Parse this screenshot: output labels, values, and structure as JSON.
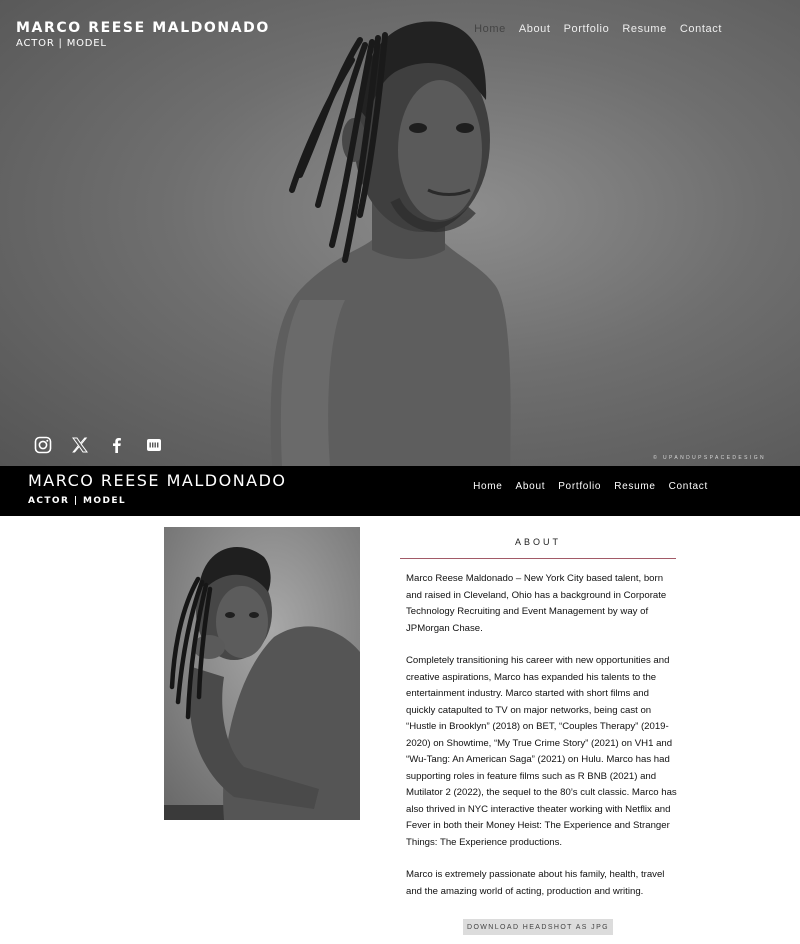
{
  "site": {
    "name": "MARCO REESE MALDONADO",
    "role": "ACTOR | MODEL",
    "bar_role": "ACTOR | MODEL"
  },
  "nav": {
    "items": [
      {
        "label": "Home"
      },
      {
        "label": "About"
      },
      {
        "label": "Portfolio"
      },
      {
        "label": "Resume"
      },
      {
        "label": "Contact"
      }
    ]
  },
  "hero": {
    "credit": "© UPANDUPSPACEDESIGN",
    "social": [
      "instagram-icon",
      "x-twitter-icon",
      "facebook-icon",
      "imdb-icon"
    ]
  },
  "about": {
    "title": "ABOUT",
    "paragraphs": [
      "Marco Reese Maldonado – New York City based talent, born and raised in Cleveland, Ohio has a background in Corporate Technology Recruiting and Event Management by way of JPMorgan Chase.",
      "Completely transitioning his career with new opportunities and creative aspirations, Marco has expanded his talents to the entertainment industry. Marco started with short films and quickly catapulted to TV on major networks, being cast on “Hustle in Brooklyn” (2018) on BET,  “Couples Therapy” (2019-2020) on Showtime, “My True Crime Story” (2021) on VH1 and “Wu-Tang: An American Saga” (2021) on Hulu. Marco has had supporting roles in feature films such as R BNB (2021) and Mutilator 2 (2022), the sequel to the 80’s cult classic. Marco has also thrived in NYC interactive theater working with Netflix and Fever in both their Money Heist: The Experience and Stranger Things: The Experience productions.",
      "Marco is extremely passionate about his family, health, travel and the amazing world of acting, production and writing."
    ],
    "download_label": "DOWNLOAD HEADSHOT AS JPG"
  }
}
